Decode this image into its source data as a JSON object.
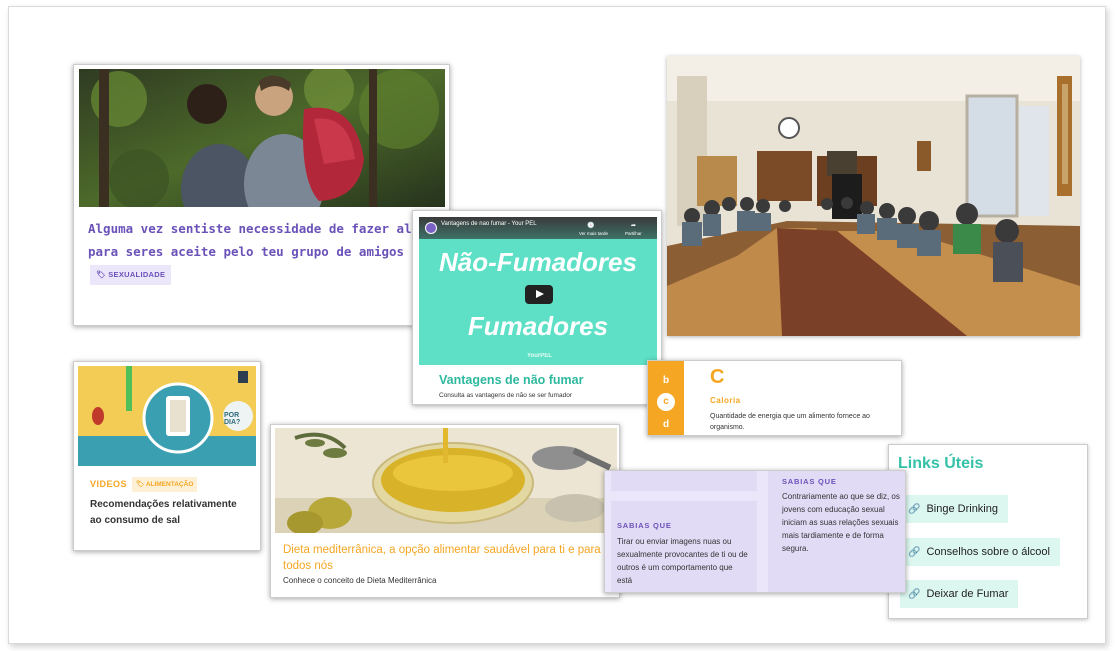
{
  "card_friends": {
    "title": "Alguma vez sentiste necessidade de fazer algo para seres aceite pelo teu grupo de amigos",
    "tag": "SEXUALIDADE"
  },
  "card_video": {
    "video_title": "Vantagens de nao fumar - Your PEL",
    "watch_later": "Ver mais tarde",
    "share": "Partilhar",
    "headline_1": "Não-Fumadores",
    "headline_2": "Fumadores",
    "watermark": "YourPEL",
    "title": "Vantagens de não fumar",
    "subtitle": "Consulta as vantagens de não se ser fumador"
  },
  "glossary": {
    "letters": [
      "b",
      "c",
      "d"
    ],
    "active_letter": "C",
    "term": "Caloria",
    "definition": "Quantidade de energia que um alimento fornece ao organismo."
  },
  "links": {
    "title": "Links Úteis",
    "items": [
      "Binge Drinking",
      "Conselhos sobre o álcool",
      "Deixar de Fumar"
    ]
  },
  "card_salt": {
    "label": "VIDEOS",
    "tag": "ALIMENTAÇÃO",
    "title": "Recomendações relativamente ao consumo de sal",
    "img_text": "POR DIA?"
  },
  "card_diet": {
    "title": "Dieta mediterrânica, a opção alimentar saudável para ti e para todos nós",
    "subtitle": "Conhece o conceito de Dieta Mediterrânica"
  },
  "sabias": {
    "left": {
      "heading": "SABIAS QUE",
      "text": "Tirar ou enviar imagens nuas ou sexualmente provocantes de ti ou de outros é um comportamento que está"
    },
    "right": {
      "heading": "SABIAS QUE",
      "text": "Contrariamente ao que se diz, os jovens com educação sexual iniciam as suas relações sexuais mais tardiamente e de forma segura."
    }
  },
  "colors": {
    "purple": "#6b52b8",
    "teal": "#33c2a8",
    "orange": "#f5a623",
    "lavender": "#e2dbf6"
  }
}
